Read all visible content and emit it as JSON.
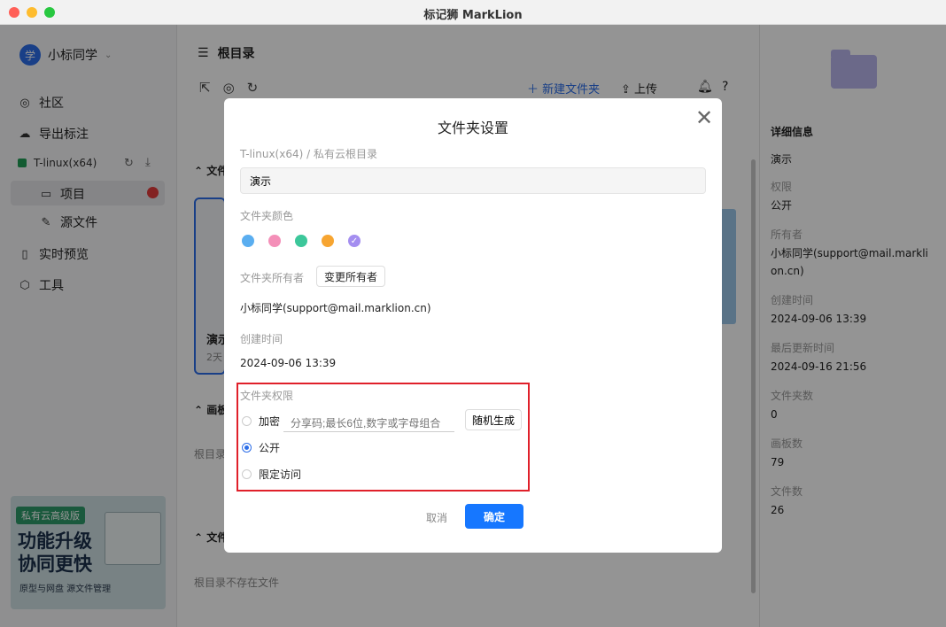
{
  "window": {
    "title": "标记狮 MarkLion"
  },
  "sidebar": {
    "user_avatar_text": "学",
    "user_name": "小标同学",
    "community": "社区",
    "export": "导出标注",
    "workspace": "T-linux(x64)",
    "project": "项目",
    "source_files": "源文件",
    "preview": "实时预览",
    "tools": "工具",
    "promo": {
      "tag": "私有云高级版",
      "line1": "功能升级",
      "line2": "协同更快",
      "sub": "原型与网盘  源文件管理"
    }
  },
  "main": {
    "breadcrumb": "根目录",
    "new_folder": "新建文件夹",
    "upload": "上传",
    "section_folders": "文件",
    "section_boards": "画板",
    "section_files": "文件",
    "card_title": "演示",
    "card_meta": "2天",
    "boards_empty": "根目录",
    "files_empty": "根目录不存在文件"
  },
  "detail": {
    "title": "详细信息",
    "name": "演示",
    "permission_label": "权限",
    "permission_value": "公开",
    "owner_label": "所有者",
    "owner_value": "小标同学(support@mail.marklion.cn)",
    "created_label": "创建时间",
    "created_value": "2024-09-06 13:39",
    "updated_label": "最后更新时间",
    "updated_value": "2024-09-16 21:56",
    "folders_label": "文件夹数",
    "folders_value": "0",
    "boards_label": "画板数",
    "boards_value": "79",
    "files_label": "文件数",
    "files_value": "26"
  },
  "modal": {
    "title": "文件夹设置",
    "path": "T-linux(x64) / 私有云根目录",
    "name_value": "演示",
    "color_label": "文件夹颜色",
    "colors": [
      "#5aaef0",
      "#f48fb8",
      "#3cc79a",
      "#f7a531",
      "#a48ef0"
    ],
    "owner_label": "文件夹所有者",
    "change_owner": "变更所有者",
    "owner_value": "小标同学(support@mail.marklion.cn)",
    "created_label": "创建时间",
    "created_value": "2024-09-06 13:39",
    "permission_label": "文件夹权限",
    "opt_encrypt": "加密",
    "password_placeholder": "分享码;最长6位,数字或字母组合",
    "random_generate": "随机生成",
    "opt_public": "公开",
    "opt_restricted": "限定访问",
    "cancel": "取消",
    "confirm": "确定"
  }
}
